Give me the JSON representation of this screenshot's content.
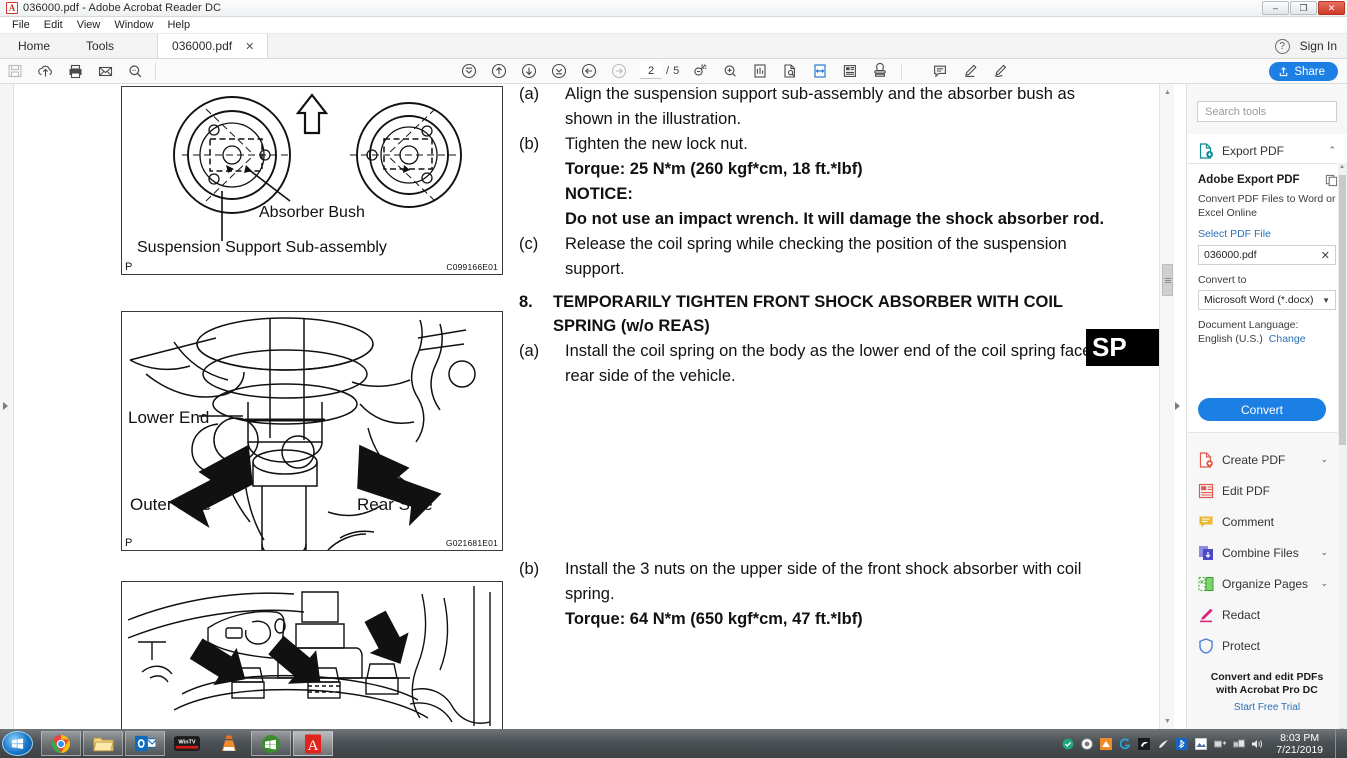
{
  "window": {
    "title": "036000.pdf - Adobe Acrobat Reader DC",
    "app_icon": "pdf-icon",
    "minimize": "–",
    "maximize": "❐",
    "close": "✕"
  },
  "menubar": {
    "items": [
      "File",
      "Edit",
      "View",
      "Window",
      "Help"
    ]
  },
  "tabstrip": {
    "home_label": "Home",
    "tools_label": "Tools",
    "document_tab": "036000.pdf",
    "document_tab_close": "✕",
    "help_label": "?",
    "sign_in_label": "Sign In"
  },
  "toolbar": {
    "left_icons": [
      "save-icon",
      "upload-cloud-icon",
      "print-icon",
      "email-icon",
      "search-icon"
    ],
    "nav_icons": [
      "first-page-icon",
      "previous-page-icon",
      "next-page-icon",
      "last-page-icon",
      "back-icon",
      "forward-icon"
    ],
    "page_current": "2",
    "page_separator": "/",
    "page_total": "5",
    "view_icons": [
      "zoom-out-icon",
      "zoom-in-icon",
      "fit-page-icon",
      "page-thumbnail-icon",
      "fit-width-icon",
      "read-mode-icon",
      "stamp-icon"
    ],
    "comment_icons": [
      "comment-icon",
      "highlight-icon",
      "sign-icon"
    ],
    "share_label": "Share",
    "share_icon": "share-upload-icon"
  },
  "document": {
    "figure1": {
      "label_absorber_bush": "Absorber Bush",
      "label_suspension_support": "Suspension Support Sub-assembly",
      "page_mark": "P",
      "code": "C099166E01"
    },
    "figure2": {
      "label_lower_end": "Lower End",
      "label_outer_side": "Outer Side",
      "label_rear_side": "Rear Side",
      "page_mark": "P",
      "code": "G021681E01"
    },
    "figure3": {
      "page_mark": "",
      "code": ""
    },
    "blocks": [
      {
        "label": "(a)",
        "text": "Align the suspension support sub-assembly and the absorber bush as shown in the illustration.",
        "bold": false
      },
      {
        "label": "(b)",
        "text": "Tighten the new lock nut.",
        "bold": false
      },
      {
        "label": "",
        "text": "Torque: 25 N*m (260 kgf*cm, 18 ft.*lbf)",
        "bold": true
      },
      {
        "label": "",
        "text": "NOTICE:",
        "bold": true
      },
      {
        "label": "",
        "text": "Do not use an impact wrench. It will damage the shock absorber rod.",
        "bold": true
      },
      {
        "label": "(c)",
        "text": "Release the coil spring while checking the position of the suspension support.",
        "bold": false
      }
    ],
    "section": {
      "number": "8.",
      "heading": "TEMPORARILY TIGHTEN FRONT SHOCK ABSORBER WITH COIL SPRING (w/o REAS)"
    },
    "step_a": {
      "label": "(a)",
      "text": "Install the coil spring on the body as the lower end of the coil spring faces rear side of the vehicle."
    },
    "step_b": {
      "label": "(b)",
      "text": "Install the 3 nuts on the upper side of the front shock absorber with coil spring."
    },
    "step_b_torque": "Torque: 64 N*m (650 kgf*cm, 47 ft.*lbf)",
    "overlay_badge": "SP"
  },
  "rightpanel": {
    "search_placeholder": "Search tools",
    "export_pdf_label": "Export PDF",
    "export_pdf_icon": "export-pdf-icon",
    "card": {
      "title": "Adobe Export PDF",
      "description": "Convert PDF Files to Word or Excel Online",
      "select_file_link": "Select PDF File",
      "file_name": "036000.pdf",
      "file_clear": "✕",
      "convert_to_label": "Convert to",
      "convert_to_value": "Microsoft Word (*.docx)",
      "doc_language_label": "Document Language:",
      "doc_language_value": "English (U.S.)",
      "change_link": "Change",
      "convert_button": "Convert"
    },
    "tools": [
      {
        "label": "Create PDF",
        "icon": "create-pdf-icon",
        "chevron": "⌄",
        "color": "#e2574c"
      },
      {
        "label": "Edit PDF",
        "icon": "edit-pdf-icon",
        "chevron": "",
        "color": "#e2574c"
      },
      {
        "label": "Comment",
        "icon": "comment-tool-icon",
        "chevron": "",
        "color": "#e8b931"
      },
      {
        "label": "Combine Files",
        "icon": "combine-files-icon",
        "chevron": "⌄",
        "color": "#5a5ad0"
      },
      {
        "label": "Organize Pages",
        "icon": "organize-pages-icon",
        "chevron": "⌄",
        "color": "#54b948"
      },
      {
        "label": "Redact",
        "icon": "redact-icon",
        "chevron": "",
        "color": "#d6257f"
      },
      {
        "label": "Protect",
        "icon": "protect-icon",
        "chevron": "",
        "color": "#4f7fd0"
      }
    ],
    "promo_line1": "Convert and edit PDFs",
    "promo_line2": "with Acrobat Pro DC",
    "promo_link": "Start Free Trial"
  },
  "taskbar": {
    "start_icon": "windows-start-icon",
    "apps": [
      {
        "name": "chrome-taskbar-icon",
        "active": false
      },
      {
        "name": "file-explorer-taskbar-icon",
        "active": false
      },
      {
        "name": "outlook-taskbar-icon",
        "active": false
      },
      {
        "name": "wintv-taskbar-icon",
        "active": false
      },
      {
        "name": "vlc-taskbar-icon",
        "active": false
      },
      {
        "name": "windows-media-center-taskbar-icon",
        "active": false
      },
      {
        "name": "adobe-reader-taskbar-icon",
        "active": true
      }
    ],
    "tray_icons": [
      "shield-check-icon",
      "antivirus-icon",
      "orange-tile-icon",
      "logitech-icon",
      "nvidia-icon",
      "audio-driver-icon",
      "bluetooth-icon",
      "display-icon",
      "usb-eject-icon",
      "network-icon",
      "volume-icon"
    ],
    "time": "8:03 PM",
    "date": "7/21/2019"
  },
  "colors": {
    "accent_blue": "#1b7fe3",
    "link_blue": "#2a6fb5",
    "taskbar": "#4c5155"
  }
}
